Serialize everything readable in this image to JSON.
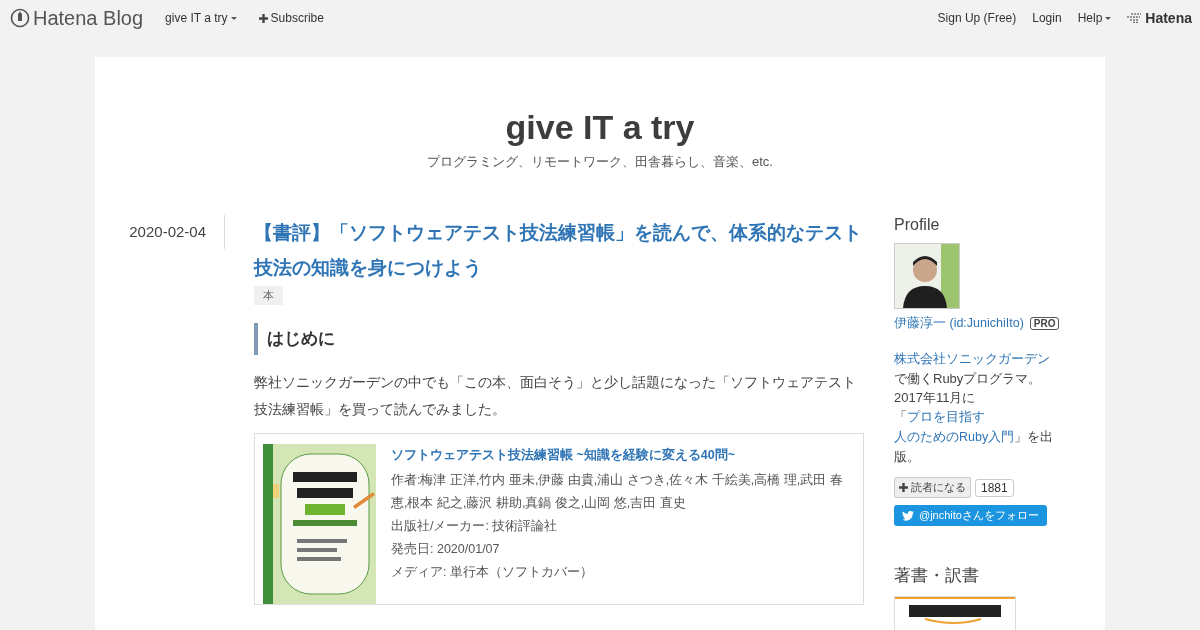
{
  "topbar": {
    "logo": "Hatena Blog",
    "blog_menu": "give IT a try",
    "subscribe": "Subscribe",
    "right_links": [
      "Sign Up (Free)",
      "Login"
    ],
    "help": "Help",
    "brand": "Hatena"
  },
  "blog": {
    "title": "give IT a try",
    "description": "プログラミング、リモートワーク、田舎暮らし、音楽、etc."
  },
  "entry": {
    "date": "2020-02-04",
    "title": "【書評】「ソフトウェアテスト技法練習帳」を読んで、体系的なテスト技法の知識を身につけよう",
    "categories": [
      "本"
    ],
    "heading": "はじめに",
    "paragraph": "弊社ソニックガーデンの中でも「この本、面白そう」と少し話題になった「ソフトウェアテスト技法練習帳」を買って読んでみました。",
    "product": {
      "title": "ソフトウェアテスト技法練習帳 ~知識を経験に変える40問~",
      "authors": "作者:梅津 正洋,竹内 亜未,伊藤 由貴,浦山 さつき,佐々木 千絵美,高橋 理,武田 春恵,根本 紀之,藤沢 耕助,真鍋 俊之,山岡 悠,吉田 直史",
      "details": [
        "出版社/メーカー: 技術評論社",
        "発売日: 2020/01/07",
        "メディア: 単行本（ソフトカバー）"
      ]
    }
  },
  "sidebar": {
    "profile": {
      "heading": "Profile",
      "name": "伊藤淳一 (id:JunichiIto)",
      "badge": "PRO",
      "bio": [
        {
          "text": "株式会社ソニックガーデン",
          "kind": "link"
        },
        {
          "text": "で働くRubyプログラマ。2017年11月に「",
          "kind": "text"
        },
        {
          "text": "プロを目指す",
          "kind": "link"
        },
        {
          "text": "人のためのRuby入門",
          "kind": "link"
        },
        {
          "text": "」を出版。",
          "kind": "text"
        }
      ],
      "reader_button": "読者になる",
      "reader_count": "1881",
      "twitter_button": "@jnchitoさんをフォロー"
    },
    "books": {
      "heading": "著書・訳書"
    }
  }
}
